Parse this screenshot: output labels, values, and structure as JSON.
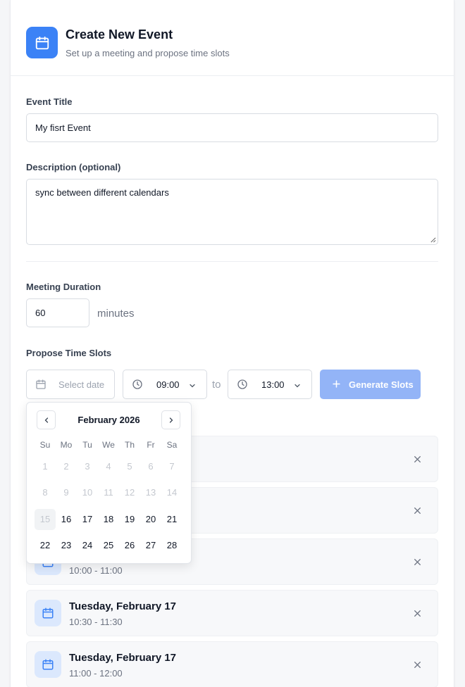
{
  "header": {
    "title": "Create New Event",
    "subtitle": "Set up a meeting and propose time slots"
  },
  "form": {
    "title_label": "Event Title",
    "title_value": "My fisrt Event",
    "description_label": "Description (optional)",
    "description_value": "sync between different calendars",
    "duration_label": "Meeting Duration",
    "duration_value": "60",
    "duration_unit": "minutes",
    "slots_label": "Propose Time Slots",
    "date_placeholder": "Select date",
    "start_time": "09:00",
    "to_label": "to",
    "end_time": "13:00",
    "generate_label": "Generate Slots"
  },
  "calendar": {
    "month_label": "February 2026",
    "weekdays": [
      "Su",
      "Mo",
      "Tu",
      "We",
      "Th",
      "Fr",
      "Sa"
    ],
    "weeks": [
      [
        "1",
        "2",
        "3",
        "4",
        "5",
        "6",
        "7"
      ],
      [
        "8",
        "9",
        "10",
        "11",
        "12",
        "13",
        "14"
      ],
      [
        "15",
        "16",
        "17",
        "18",
        "19",
        "20",
        "21"
      ],
      [
        "22",
        "23",
        "24",
        "25",
        "26",
        "27",
        "28"
      ]
    ]
  },
  "slots": [
    {
      "day": "",
      "time": ""
    },
    {
      "day": "",
      "time": ""
    },
    {
      "day": "",
      "time": "10:00 - 11:00"
    },
    {
      "day": "Tuesday, February 17",
      "time": "10:30 - 11:30"
    },
    {
      "day": "Tuesday, February 17",
      "time": "11:00 - 12:00"
    }
  ],
  "colors": {
    "accent": "#3b82f6",
    "accent_disabled": "#93b4f7",
    "slot_icon_bg": "#dbe8fd"
  }
}
